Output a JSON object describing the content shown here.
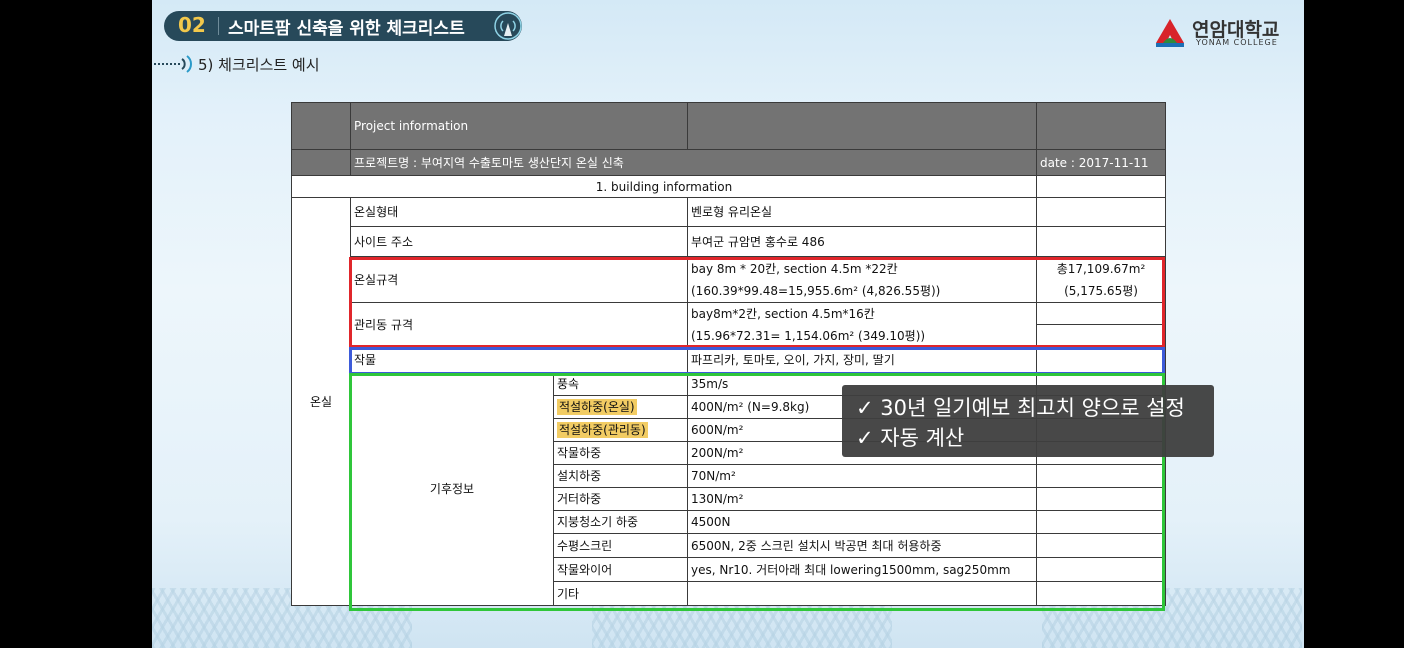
{
  "header": {
    "section_number": "02",
    "section_title": "스마트팜 신축을 위한 체크리스트",
    "subsection_title": "5) 체크리스트 예시"
  },
  "logo": {
    "name": "연암대학교",
    "subtitle": "YONAM COLLEGE"
  },
  "table": {
    "project_header": "Project information",
    "project_name": "프로젝트명 : 부여지역 수출토마토 생산단지 온실 신축",
    "date": "date : 2017-11-11",
    "section_label": "1. building information",
    "group_label": "온실",
    "climate_label": "기후정보",
    "rows": {
      "type_label": "온실형태",
      "type_value": "벤로형 유리온실",
      "site_label": "사이트 주소",
      "site_value": "부여군 규암면 홍수로 486",
      "spec_label": "온실규격",
      "spec_value_1": "bay 8m * 20칸, section 4.5m *22칸",
      "spec_value_2": "(160.39*99.48=15,955.6m²  (4,826.55평))",
      "spec_total_1": "총17,109.67m²",
      "spec_total_2": "(5,175.65평)",
      "mgmt_label": "관리동 규격",
      "mgmt_value_1": " bay8m*2칸, section 4.5m*16칸",
      "mgmt_value_2": "(15.96*72.31= 1,154.06m² (349.10평))",
      "crop_label": "작물",
      "crop_value": "파프리카, 토마토, 오이, 가지, 장미, 딸기"
    },
    "climate": [
      {
        "label": "풍속",
        "value": "35m/s"
      },
      {
        "label": "적설하중(온실)",
        "value": "400N/m²  (N=9.8kg)"
      },
      {
        "label": "적설하중(관리동)",
        "value": "600N/m²"
      },
      {
        "label": "작물하중",
        "value": "200N/m²"
      },
      {
        "label": "설치하중",
        "value": "70N/m²"
      },
      {
        "label": "거터하중",
        "value": "130N/m²"
      },
      {
        "label": "지붕청소기 하중",
        "value": "4500N"
      },
      {
        "label": "수평스크린",
        "value": "6500N, 2중 스크린 설치시 박공면 최대 허용하중"
      },
      {
        "label": "작물와이어",
        "value": "yes, Nr10. 거터아래 최대 lowering1500mm, sag250mm"
      },
      {
        "label": "기타",
        "value": ""
      }
    ]
  },
  "callout": {
    "line1": "✓ 30년 일기예보 최고치 양으로 설정",
    "line2": "✓ 자동 계산"
  },
  "colors": {
    "badge": "#27495a",
    "badge_number": "#f2c84b",
    "header_gray": "#737373",
    "highlight": "#f2cc63",
    "frame_red": "#e0262b",
    "frame_blue": "#3d5bd9",
    "frame_green": "#2fc63a"
  }
}
